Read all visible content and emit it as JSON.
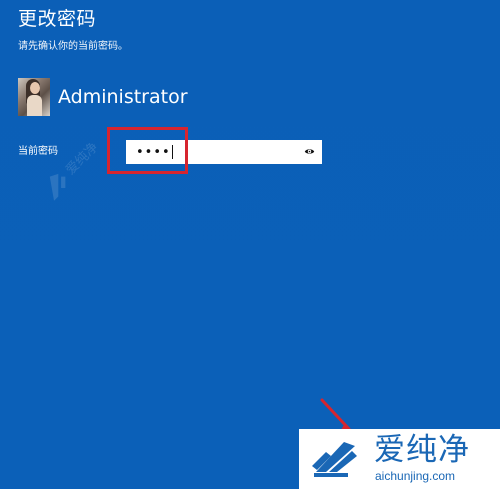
{
  "title": "更改密码",
  "subtitle": "请先确认你的当前密码。",
  "user": {
    "name": "Administrator",
    "avatar_icon": "user-avatar-icon"
  },
  "password_field": {
    "label": "当前密码",
    "value": "••••",
    "reveal_icon": "eye-icon"
  },
  "watermark": {
    "brand_cn": "爱纯净",
    "brand_domain": "aichunjing.com"
  },
  "colors": {
    "background": "#0b60b8",
    "highlight": "#d6252f",
    "brand": "#1a67b5"
  }
}
